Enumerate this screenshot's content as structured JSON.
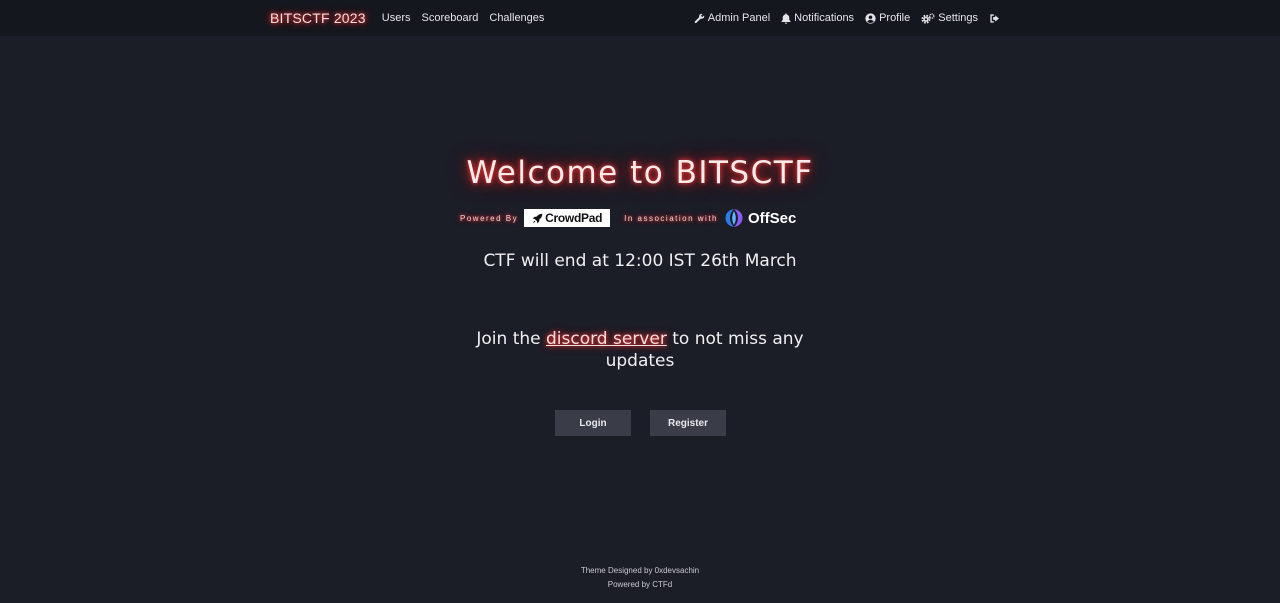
{
  "navbar": {
    "brand": "BITSCTF 2023",
    "left_links": [
      "Users",
      "Scoreboard",
      "Challenges"
    ],
    "right_links": {
      "admin": "Admin Panel",
      "notifications": "Notifications",
      "profile": "Profile",
      "settings": "Settings"
    }
  },
  "hero": {
    "title": "Welcome to BITSCTF",
    "powered_by": "Powered By",
    "crowdpad": "CrowdPad",
    "association": "In association with",
    "offsec": "OffSec",
    "end_time": "CTF will end at 12:00 IST 26th March",
    "join_prefix": "Join the ",
    "join_link": "discord server",
    "join_suffix": " to not miss any updates"
  },
  "buttons": {
    "login": "Login",
    "register": "Register"
  },
  "footer": {
    "line1": "Theme Designed by 0xdevsachin",
    "line2": "Powered by CTFd"
  },
  "colors": {
    "background": "#1b1d27",
    "navbar": "#15171e",
    "glow": "#ff3b3b",
    "button": "#3a3d48"
  }
}
